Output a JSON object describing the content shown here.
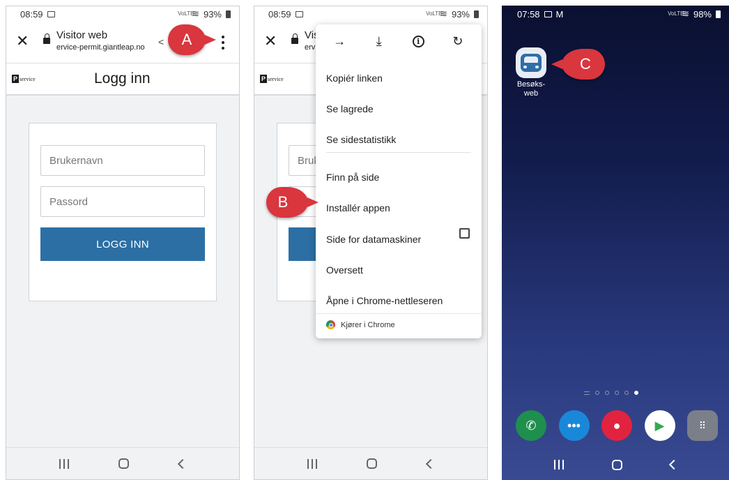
{
  "phone1": {
    "status": {
      "time": "08:59",
      "network": "VoLTE",
      "battery": "93%"
    },
    "toolbar": {
      "title": "Visitor web",
      "url": "ervice-permit.giantleap.no"
    },
    "appbar": {
      "logo_letter": "P",
      "logo_text": "service",
      "title": "Logg inn"
    },
    "login": {
      "username_placeholder": "Brukernavn",
      "password_placeholder": "Passord",
      "button_label": "LOGG INN"
    }
  },
  "phone2": {
    "status": {
      "time": "08:59",
      "network": "VoLTE",
      "battery": "93%"
    },
    "toolbar": {
      "title": "Vis",
      "url": "ervi"
    },
    "appbar": {
      "logo_letter": "P",
      "logo_text": "service"
    },
    "login": {
      "username_placeholder": "Bruk"
    },
    "menu": {
      "items": [
        "Kopiér linken",
        "Se lagrede",
        "Se sidestatistikk",
        "Finn på side",
        "Installér appen",
        "Side for datamaskiner",
        "Oversett",
        "Åpne i Chrome-nettleseren"
      ],
      "footer": "Kjører i Chrome"
    }
  },
  "phone3": {
    "status": {
      "time": "07:58",
      "network": "VoLTE",
      "battery": "98%"
    },
    "app_label": "Besøks-\nweb"
  },
  "callouts": {
    "a": "A",
    "b": "B",
    "c": "C"
  },
  "colors": {
    "accent_blue": "#2c6fa4",
    "callout_red": "#d9363e"
  },
  "icons": [
    "close-icon",
    "lock-icon",
    "share-icon",
    "more-vert-icon",
    "forward-arrow-icon",
    "download-icon",
    "info-icon",
    "refresh-icon",
    "chrome-icon",
    "car-icon",
    "phone-icon",
    "messages-icon",
    "camera-icon",
    "play-store-icon",
    "apps-grid-icon"
  ]
}
